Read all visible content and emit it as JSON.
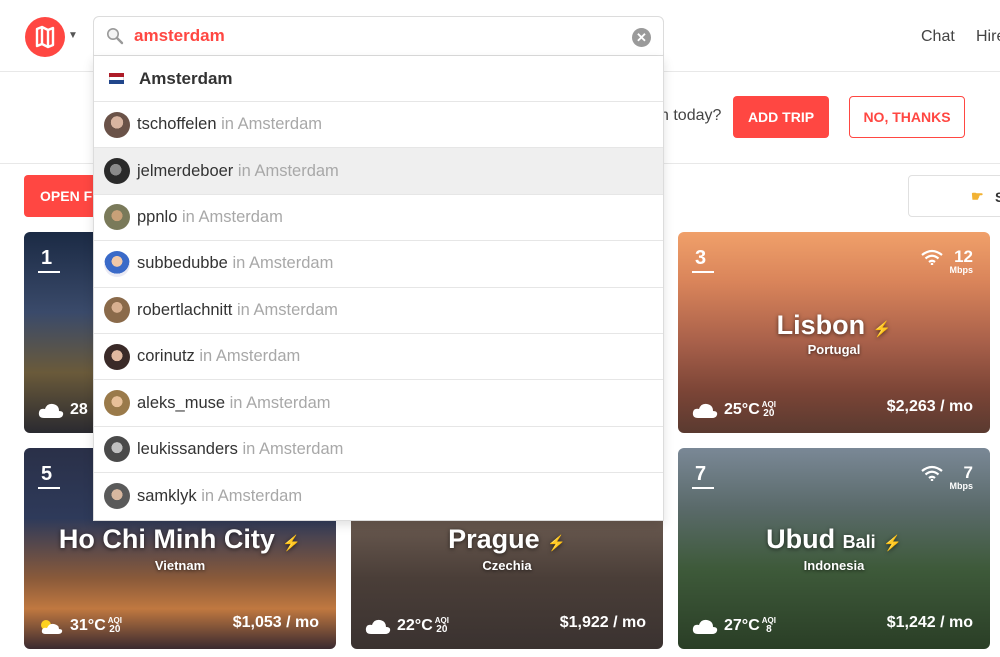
{
  "header": {
    "nav": [
      "Chat",
      "Hire"
    ]
  },
  "search": {
    "value": "amsterdam"
  },
  "dropdown": {
    "city": "Amsterdam",
    "in_label": "in",
    "users": [
      {
        "name": "tschoffelen",
        "city": "Amsterdam"
      },
      {
        "name": "jelmerdeboer",
        "city": "Amsterdam"
      },
      {
        "name": "ppnlo",
        "city": "Amsterdam"
      },
      {
        "name": "subbedubbe",
        "city": "Amsterdam"
      },
      {
        "name": "robertlachnitt",
        "city": "Amsterdam"
      },
      {
        "name": "corinutz",
        "city": "Amsterdam"
      },
      {
        "name": "aleks_muse",
        "city": "Amsterdam"
      },
      {
        "name": "leukissanders",
        "city": "Amsterdam"
      },
      {
        "name": "samklyk",
        "city": "Amsterdam"
      }
    ]
  },
  "banner": {
    "question_tail": "n today?",
    "add_trip": "ADD TRIP",
    "no_thanks": "NO, THANKS"
  },
  "toolbar": {
    "open_filters": "OPEN FI",
    "sort_partial": "S"
  },
  "colors": {
    "accent": "#ff4742",
    "bolt": "#ffd21f"
  },
  "cards": [
    {
      "rank": "1",
      "temp": "28",
      "aqi": "",
      "city": "",
      "country": "",
      "cost": ""
    },
    {
      "rank": "3",
      "city": "Lisbon",
      "country": "Portugal",
      "temp": "25°C",
      "aqi_label": "AQI",
      "aqi": "20",
      "cost": "$2,263 / mo",
      "wifi": "12",
      "wifi_unit": "Mbps"
    },
    {
      "rank": "5",
      "city": "Ho Chi Minh City",
      "country": "Vietnam",
      "temp": "31°C",
      "aqi_label": "AQI",
      "aqi": "20",
      "cost": "$1,053 / mo"
    },
    {
      "city": "Prague",
      "country": "Czechia",
      "temp": "22°C",
      "aqi_label": "AQI",
      "aqi": "20",
      "cost": "$1,922 / mo"
    },
    {
      "rank": "7",
      "city": "Ubud",
      "city_sub": "Bali",
      "country": "Indonesia",
      "temp": "27°C",
      "aqi_label": "AQI",
      "aqi": "8",
      "cost": "$1,242 / mo",
      "wifi": "7",
      "wifi_unit": "Mbps"
    }
  ]
}
